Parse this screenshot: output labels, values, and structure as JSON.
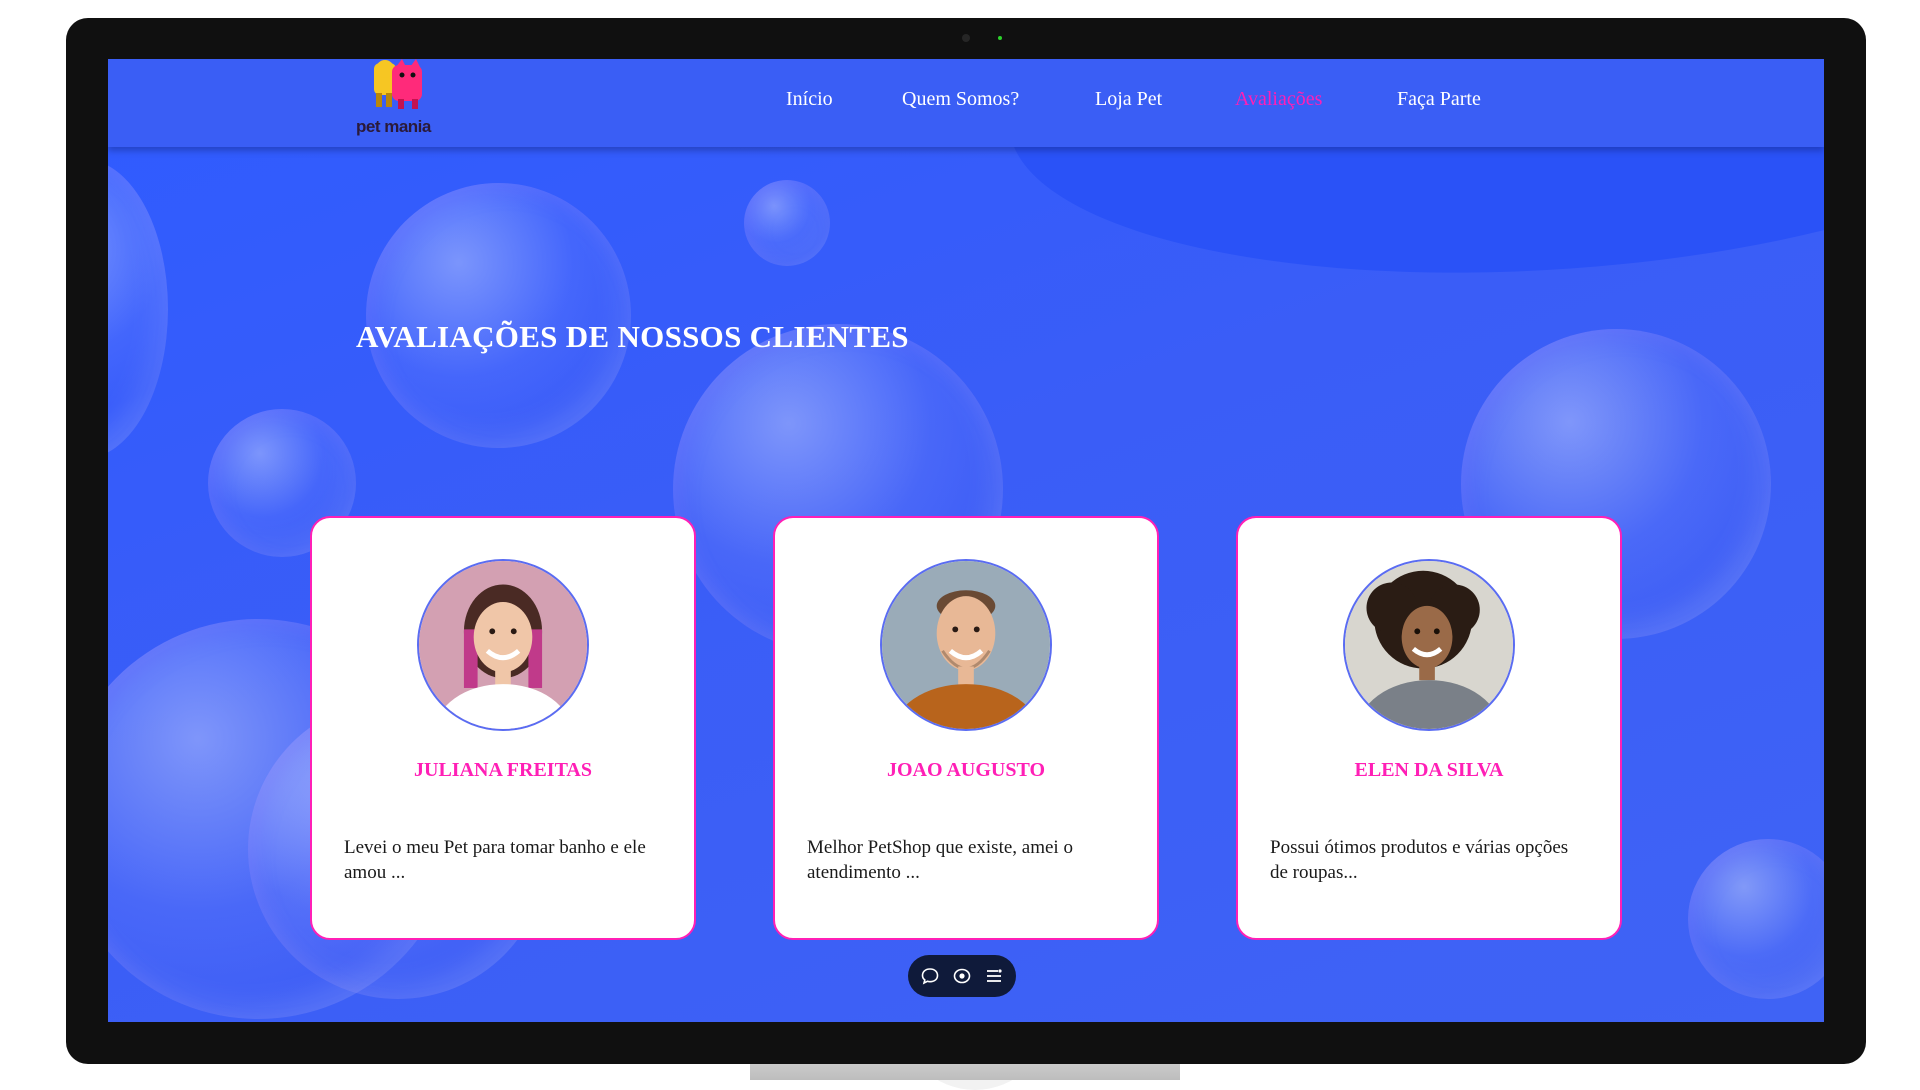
{
  "brand": {
    "name": "pet mania"
  },
  "nav": {
    "items": [
      {
        "label": "Início"
      },
      {
        "label": "Quem Somos?"
      },
      {
        "label": "Loja Pet"
      },
      {
        "label": "Avaliações",
        "active": true
      },
      {
        "label": "Faça Parte"
      }
    ]
  },
  "section": {
    "title": "AVALIAÇÕES DE NOSSOS CLIENTES"
  },
  "reviews": [
    {
      "name": "JULIANA FREITAS",
      "text": "Levei o meu Pet para tomar banho e ele amou ..."
    },
    {
      "name": "JOAO AUGUSTO",
      "text": "Melhor PetShop que existe, amei o atendimento ..."
    },
    {
      "name": "ELEN DA SILVA",
      "text": "Possui ótimos produtos e várias opções de roupas..."
    }
  ],
  "toolbar": {
    "icons": [
      "chat-icon",
      "eye-icon",
      "menu-icon"
    ]
  },
  "colors": {
    "accent": "#ff1fb6",
    "background": "#3a5ef5",
    "card": "#ffffff"
  }
}
